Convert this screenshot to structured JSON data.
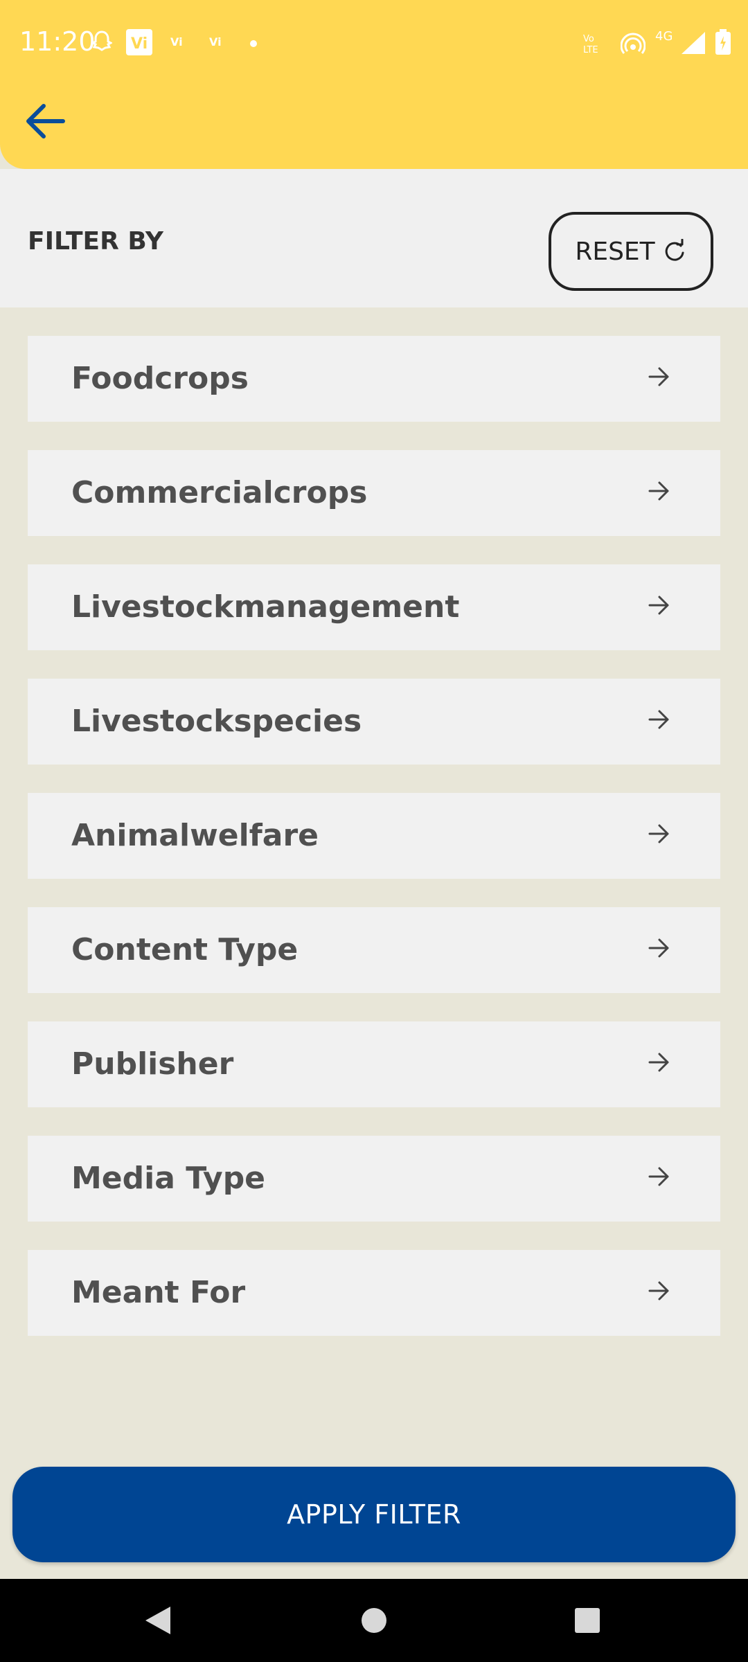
{
  "status_bar": {
    "time": "11:20",
    "left_icons": [
      "snapchat-icon",
      "vi-icon",
      "vi-small-icon",
      "vi-small-icon",
      "dot-icon"
    ],
    "right_icons": [
      "volte-icon",
      "hotspot-icon",
      "4g-icon",
      "signal-icon",
      "battery-icon"
    ],
    "network_label": "4G",
    "volte_label": "Vo LTE"
  },
  "header": {
    "back_icon": "arrow-left-icon",
    "background": "#ffd853",
    "accent": "#0a4d9a"
  },
  "filter": {
    "title": "FILTER BY",
    "reset_label": "RESET",
    "reset_icon": "refresh-icon"
  },
  "items": [
    {
      "label": "Foodcrops"
    },
    {
      "label": "Commercialcrops"
    },
    {
      "label": "Livestockmanagement"
    },
    {
      "label": "Livestockspecies"
    },
    {
      "label": "Animalwelfare"
    },
    {
      "label": "Content Type"
    },
    {
      "label": "Publisher"
    },
    {
      "label": "Media Type"
    },
    {
      "label": "Meant For"
    }
  ],
  "apply": {
    "label": "APPLY FILTER",
    "color": "#004593"
  },
  "navbar": {
    "icons": [
      "back-triangle-icon",
      "home-circle-icon",
      "recents-square-icon"
    ]
  }
}
